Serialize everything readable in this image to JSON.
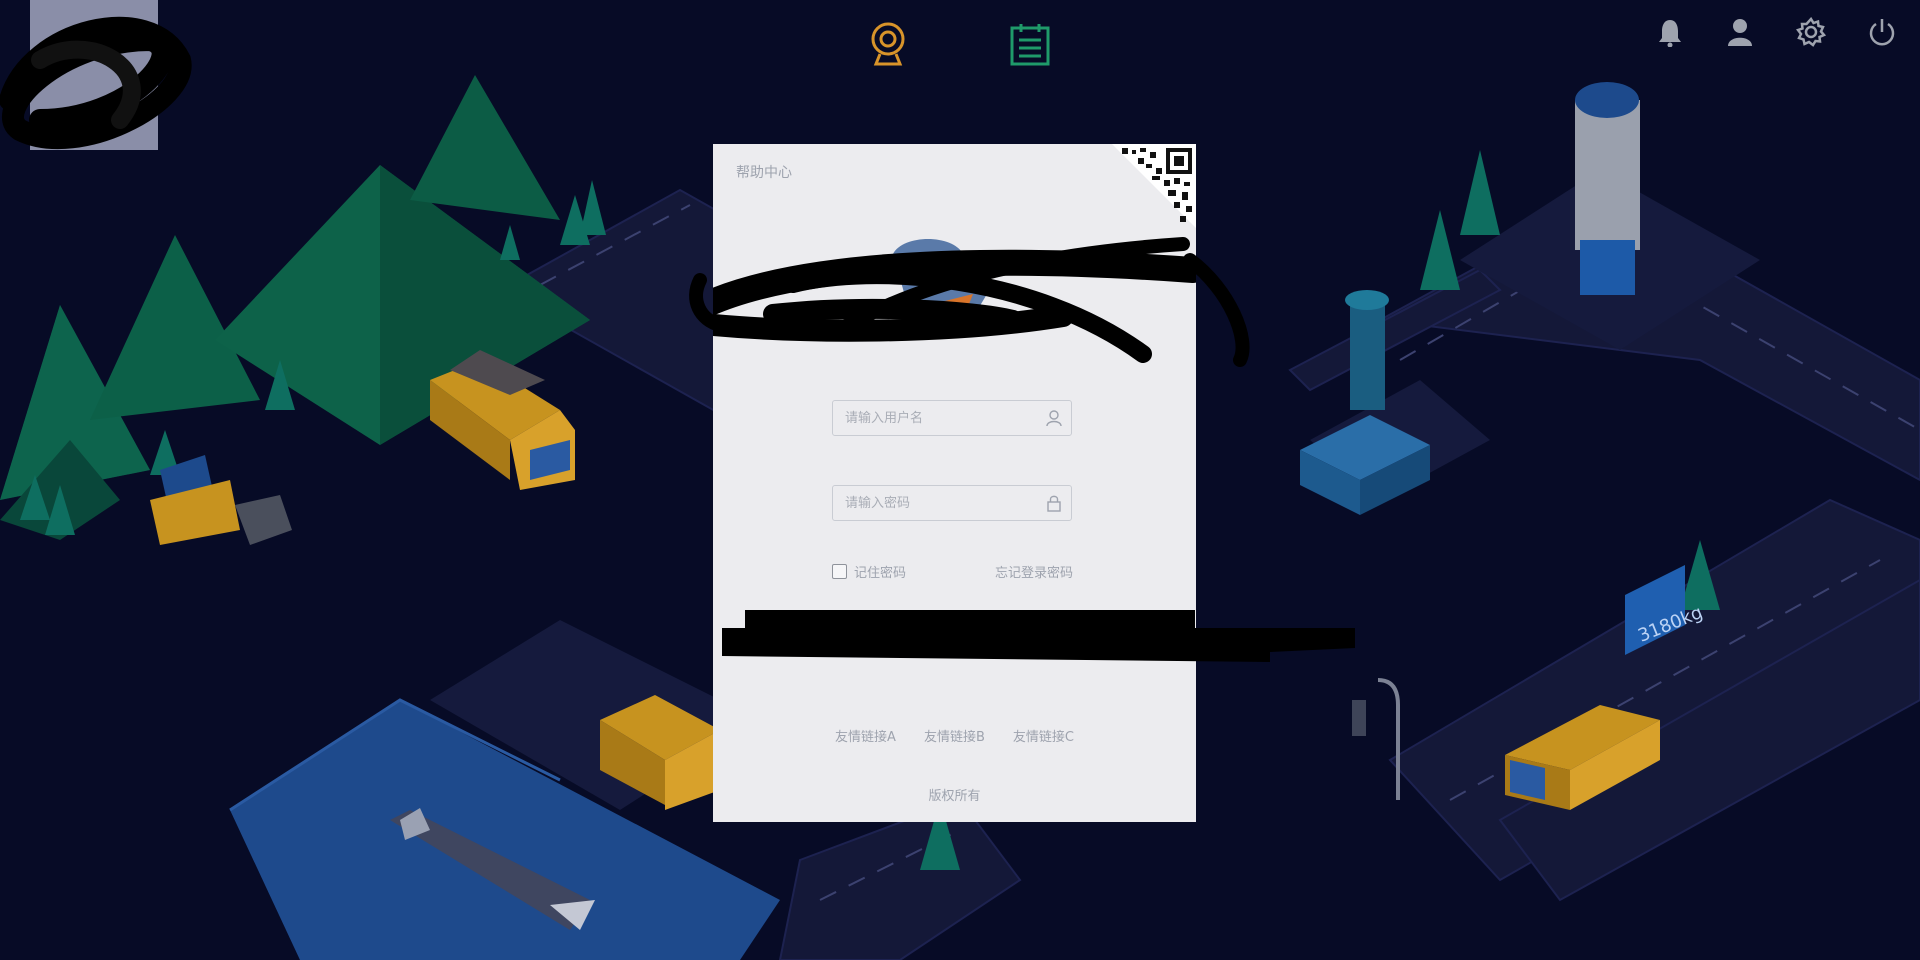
{
  "nav": {
    "top_icons": [
      "monitor-camera-icon",
      "report-clipboard-icon"
    ],
    "right_icons": [
      "bell-icon",
      "user-icon",
      "gear-icon",
      "power-icon"
    ]
  },
  "login": {
    "help_link": "帮助中心",
    "username_placeholder": "请输入用户名",
    "password_placeholder": "请输入密码",
    "remember_label": "记住密码",
    "forgot_link": "忘记登录密码",
    "friend_links": [
      "友情链接A",
      "友情链接B",
      "友情链接C"
    ],
    "copyright": "版权所有"
  },
  "scene": {
    "weight_label": "3180kg"
  },
  "colors": {
    "background": "#070b26",
    "road": "#161a3e",
    "mountain": "#0c5a47",
    "truck_yellow": "#d9a22a",
    "water": "#1d4a8a",
    "nav_orange": "#d8942a",
    "nav_green": "#1f9a6a",
    "card": "#ececef"
  }
}
